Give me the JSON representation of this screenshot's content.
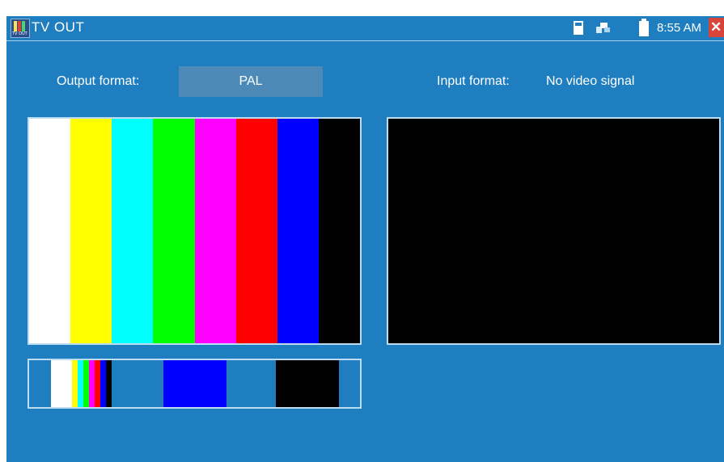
{
  "titlebar": {
    "app_icon_name": "tv-out-app-icon",
    "title": "TV OUT"
  },
  "status": {
    "time": "8:55 AM",
    "icons": [
      "sd-card-icon",
      "network-icon",
      "battery-icon"
    ]
  },
  "output": {
    "label": "Output format:",
    "format": "PAL",
    "color_bars": [
      "#ffffff",
      "#ffff00",
      "#00ffff",
      "#00ff00",
      "#ff00ff",
      "#ff0000",
      "#0000ff",
      "#000000"
    ]
  },
  "input": {
    "label": "Input format:",
    "value": "No video signal"
  },
  "patterns": [
    {
      "name": "color-bars-pattern"
    },
    {
      "name": "blue-screen-pattern",
      "color": "#0000ff"
    },
    {
      "name": "black-screen-pattern",
      "color": "#000000"
    }
  ],
  "colors": {
    "background": "#1e7ec0",
    "button": "#4d8ab8",
    "close": "#d9443a"
  }
}
